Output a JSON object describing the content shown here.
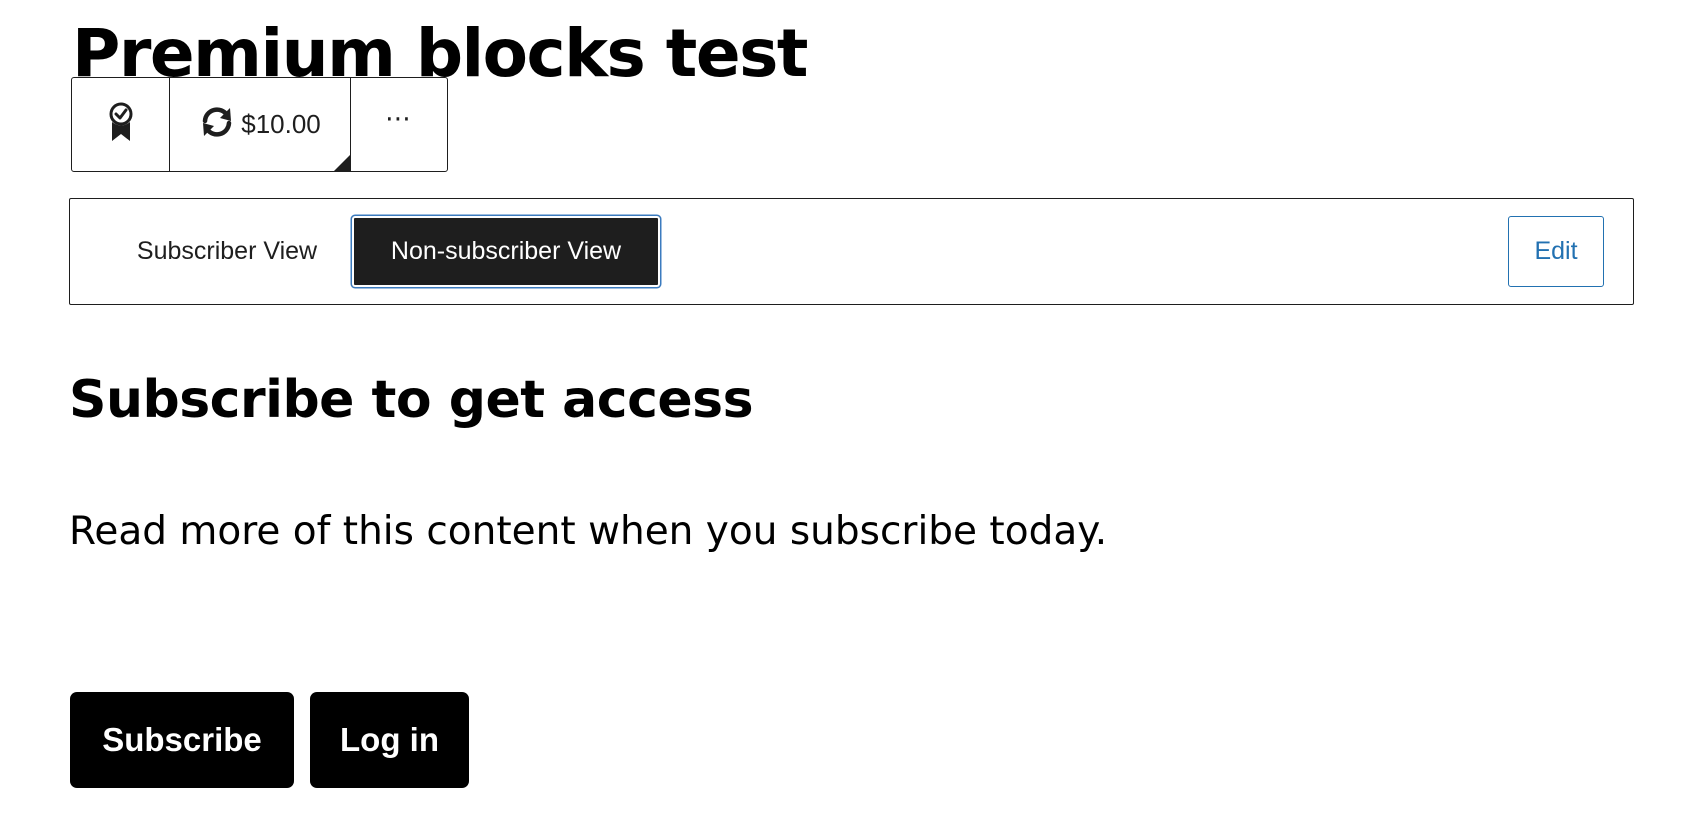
{
  "post": {
    "title": "Premium blocks test"
  },
  "toolbar": {
    "block_icon": "premium-award-icon",
    "plan_icon": "sync-icon",
    "plan_price": "$10.00",
    "more_icon": "more-options-icon",
    "more_label": "⋯"
  },
  "view_switcher": {
    "subscriber_label": "Subscriber View",
    "nonsubscriber_label": "Non-subscriber View",
    "selected": "Non-subscriber View",
    "edit_label": "Edit"
  },
  "content": {
    "heading": "Subscribe to get access",
    "text": "Read more of this content when you subscribe today.",
    "subscribe_label": "Subscribe",
    "login_label": "Log in"
  },
  "colors": {
    "accent_blue": "#2271b1",
    "dark": "#1e1e1e",
    "button_black": "#000000"
  }
}
